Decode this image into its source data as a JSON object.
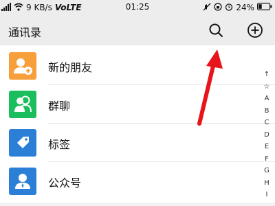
{
  "status_bar": {
    "network_speed": "9 KB/s",
    "volte": "VoLTE",
    "time": "01:25",
    "battery": "24%"
  },
  "header": {
    "title": "通讯录"
  },
  "contacts_menu": [
    {
      "label": "新的朋友",
      "color": "#f7a03b",
      "icon": "add-friend-icon"
    },
    {
      "label": "群聊",
      "color": "#1bbe5d",
      "icon": "group-chat-icon"
    },
    {
      "label": "标签",
      "color": "#2b7fd6",
      "icon": "tag-icon"
    },
    {
      "label": "公众号",
      "color": "#2b7fd6",
      "icon": "official-account-icon"
    }
  ],
  "alphabet_index": [
    "↑",
    "☆",
    "A",
    "B",
    "C",
    "D",
    "E",
    "F",
    "G",
    "H",
    "I"
  ],
  "annotation": {
    "color": "#e8141b"
  }
}
